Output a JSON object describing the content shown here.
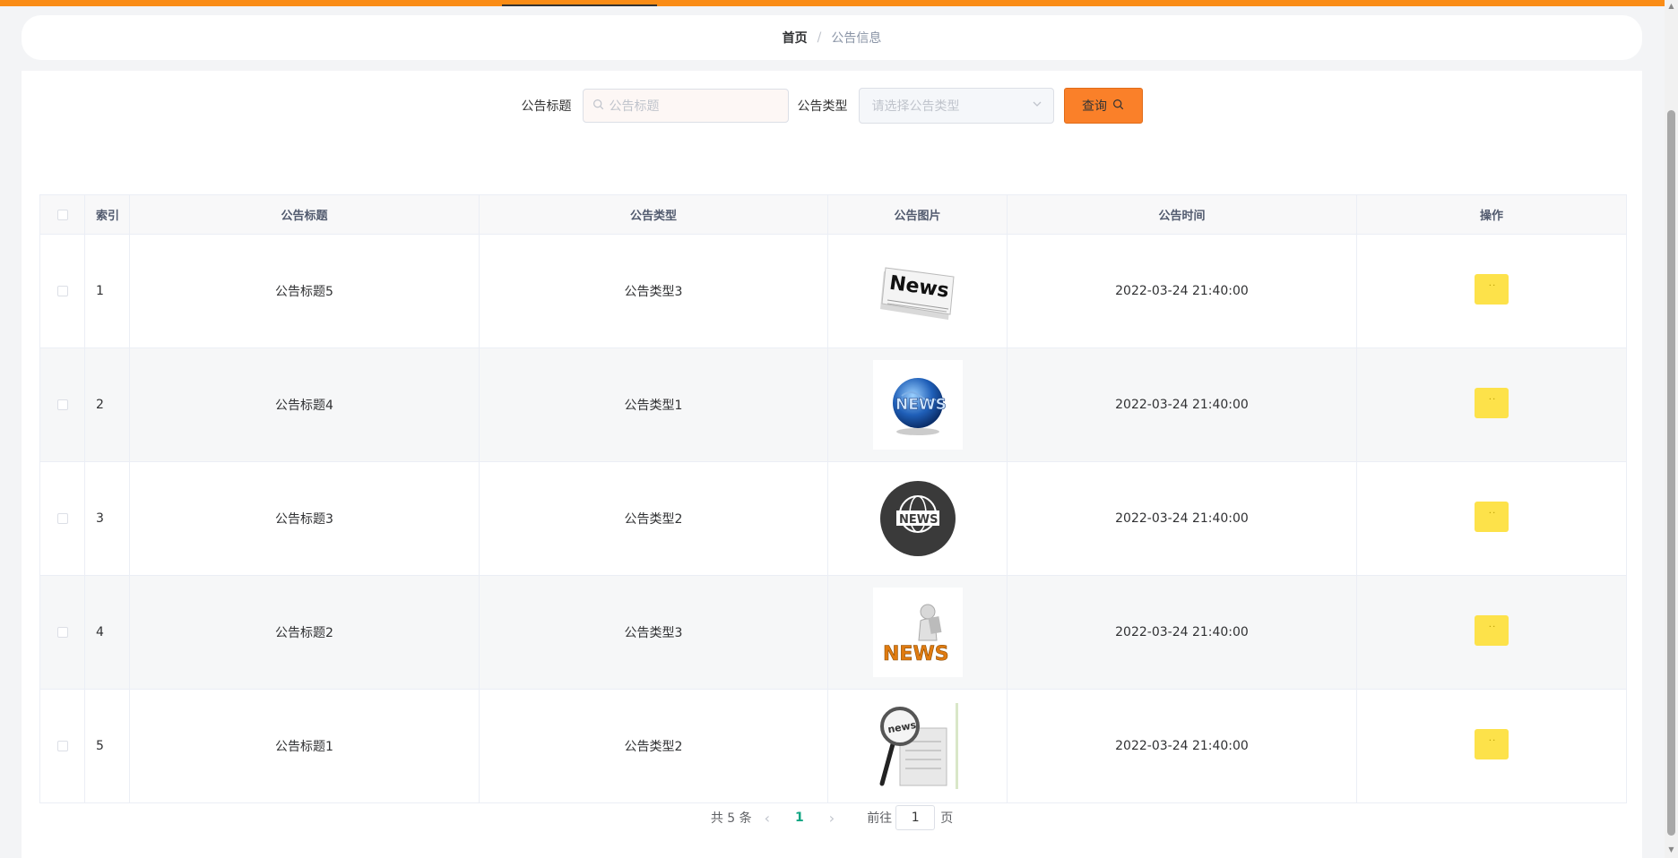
{
  "breadcrumb": {
    "home": "首页",
    "separator": "/",
    "current": "公告信息"
  },
  "search": {
    "title_label": "公告标题",
    "title_placeholder": "公告标题",
    "type_label": "公告类型",
    "type_placeholder": "请选择公告类型",
    "query_label": "查询"
  },
  "table": {
    "headers": {
      "index": "索引",
      "title": "公告标题",
      "type": "公告类型",
      "image": "公告图片",
      "time": "公告时间",
      "actions": "操作"
    },
    "rows": [
      {
        "index": "1",
        "title": "公告标题5",
        "type": "公告类型3",
        "time": "2022-03-24 21:40:00",
        "image_icon": "newspaper-news-icon"
      },
      {
        "index": "2",
        "title": "公告标题4",
        "type": "公告类型1",
        "time": "2022-03-24 21:40:00",
        "image_icon": "globe-news-icon"
      },
      {
        "index": "3",
        "title": "公告标题3",
        "type": "公告类型2",
        "time": "2022-03-24 21:40:00",
        "image_icon": "world-news-badge-icon"
      },
      {
        "index": "4",
        "title": "公告标题2",
        "type": "公告类型3",
        "time": "2022-03-24 21:40:00",
        "image_icon": "person-reading-news-icon"
      },
      {
        "index": "5",
        "title": "公告标题1",
        "type": "公告类型2",
        "time": "2022-03-24 21:40:00",
        "image_icon": "magnifier-news-icon"
      }
    ]
  },
  "pagination": {
    "total_text": "共 5 条",
    "current_page": "1",
    "goto_prefix": "前往",
    "goto_value": "1",
    "goto_suffix": "页"
  },
  "colors": {
    "accent": "#fa8c16",
    "query_button": "#fa8029",
    "action_button": "#fde24a",
    "active_page": "#11a683"
  }
}
